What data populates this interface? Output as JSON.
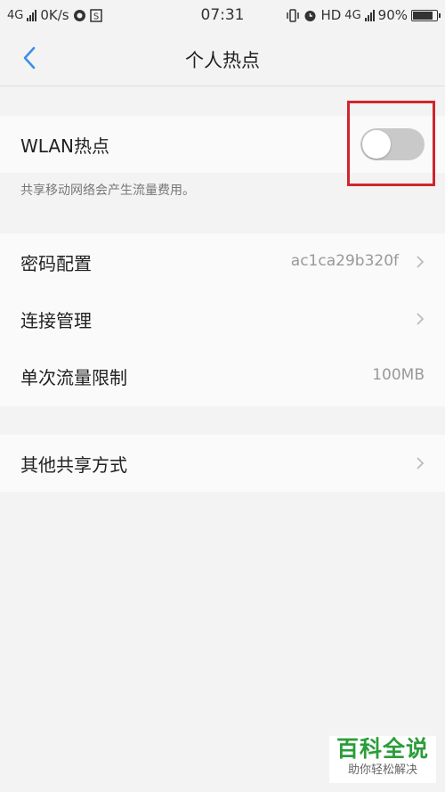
{
  "status_bar": {
    "network": "4G",
    "speed": "0K/s",
    "time": "07:31",
    "hd": "HD",
    "network_right": "4G",
    "battery": "90%",
    "battery_level": 0.9
  },
  "nav": {
    "title": "个人热点"
  },
  "hotspot": {
    "label": "WLAN热点",
    "enabled": false,
    "hint": "共享移动网络会产生流量费用。"
  },
  "settings": [
    {
      "label": "密码配置",
      "value": "ac1ca29b320f",
      "arrow": true
    },
    {
      "label": "连接管理",
      "value": "",
      "arrow": true
    },
    {
      "label": "单次流量限制",
      "value": "100MB",
      "arrow": false
    }
  ],
  "other": {
    "label": "其他共享方式"
  },
  "watermark": {
    "line1": "百科全说",
    "line2": "助你轻松解决"
  },
  "colors": {
    "accent": "#3a8ee6",
    "highlight": "#d0262c",
    "toggle_off": "#c9c9c9",
    "watermark": "#2a9d3a"
  }
}
